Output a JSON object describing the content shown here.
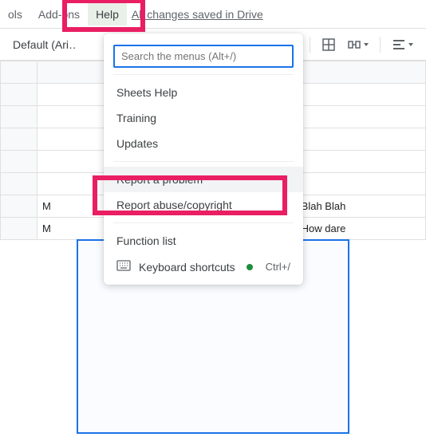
{
  "menubar": {
    "tools": "ols",
    "addons": "Add-ons",
    "help": "Help",
    "saved": "All changes saved in Drive"
  },
  "toolbar": {
    "font": "Default (Ari…"
  },
  "sheet": {
    "rows": [
      {
        "a": "",
        "b": "",
        "c": ""
      },
      {
        "a": "",
        "b": "",
        "c": ""
      },
      {
        "a": "",
        "b": "",
        "c": ""
      },
      {
        "a": "",
        "b": "",
        "c": ""
      },
      {
        "a": "",
        "b": "",
        "c": ""
      },
      {
        "a": "M",
        "b": "",
        "c": "Blah Blah"
      },
      {
        "a": "M",
        "b": "",
        "c": "How dare"
      }
    ]
  },
  "dropdown": {
    "search_placeholder": "Search the menus (Alt+/)",
    "items": {
      "sheets_help": "Sheets Help",
      "training": "Training",
      "updates": "Updates",
      "report_problem": "Report a problem",
      "report_abuse": "Report abuse/copyright",
      "function_list": "Function list",
      "keyboard_shortcuts": "Keyboard shortcuts",
      "shortcut": "Ctrl+/"
    }
  }
}
